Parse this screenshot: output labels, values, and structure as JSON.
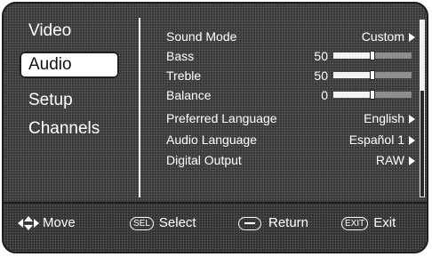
{
  "side_menu": {
    "items": [
      {
        "label": "Video",
        "selected": false
      },
      {
        "label": "Audio",
        "selected": true
      },
      {
        "label": "Setup",
        "selected": false
      },
      {
        "label": "Channels",
        "selected": false
      }
    ]
  },
  "audio_menu": {
    "sound_mode": {
      "label": "Sound Mode",
      "value": "Custom"
    },
    "bass": {
      "label": "Bass",
      "value": "50",
      "level": 0.5
    },
    "treble": {
      "label": "Treble",
      "value": "50",
      "level": 0.5
    },
    "balance": {
      "label": "Balance",
      "value": "0",
      "level": 0.5
    },
    "preferred_language": {
      "label": "Preferred Language",
      "value": "English"
    },
    "audio_language": {
      "label": "Audio Language",
      "value": "Español 1"
    },
    "digital_output": {
      "label": "Digital Output",
      "value": "RAW"
    }
  },
  "footer": {
    "move": "Move",
    "sel_badge": "SEL",
    "select": "Select",
    "return": "Return",
    "exit_badge": "EXIT",
    "exit": "Exit"
  },
  "colors": {
    "panel": "#3a3a3a",
    "text": "#ffffff",
    "highlight": "#ffffff"
  }
}
